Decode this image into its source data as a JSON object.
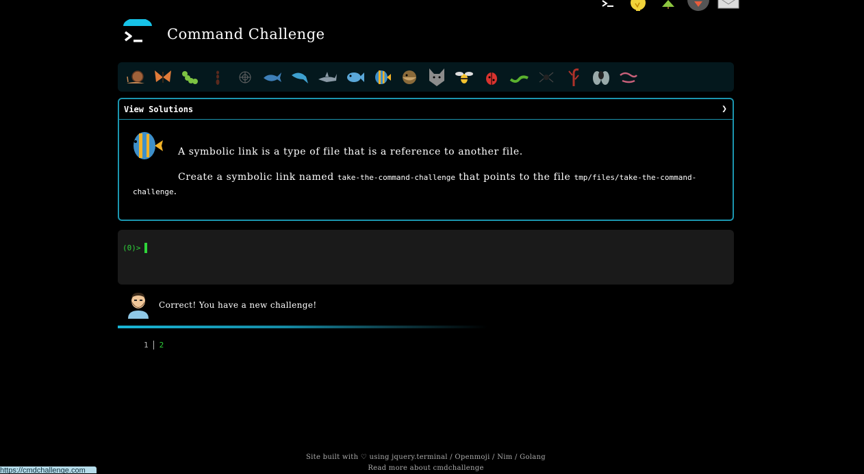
{
  "header": {
    "title": "Command Challenge"
  },
  "top_icons": [
    "terminal-icon",
    "bulb-icon",
    "tree-icon",
    "gem-icon",
    "mail-icon"
  ],
  "levels": [
    "snail",
    "butterfly",
    "caterpillar",
    "ant",
    "spider-web",
    "whale",
    "dolphin",
    "shark",
    "fish",
    "tropical-fish",
    "blowfish",
    "wolf",
    "bee",
    "ladybug",
    "worm",
    "spider",
    "scorpion",
    "fly",
    "earthworm"
  ],
  "panel": {
    "toggle_label": "View Solutions",
    "chevron": "❯",
    "desc_line1": "A symbolic link is a type of file that is a reference to another file.",
    "desc_line2_pre": "Create a symbolic link named ",
    "desc_code1": "take-the-command-challenge",
    "desc_line2_mid": " that points to the file ",
    "desc_code2": "tmp/files/take-the-command-challenge",
    "desc_line2_end": "."
  },
  "terminal": {
    "prompt": "(0)>"
  },
  "feedback": {
    "message": "Correct! You have a new challenge!"
  },
  "progress": {
    "fraction": 0.6
  },
  "steps": {
    "first": "1",
    "second": "2"
  },
  "footer": {
    "line1": "Site built with ♡ using jquery.terminal / Openmoji / Nim / Golang",
    "line2": "Read more about cmdchallenge"
  },
  "status_bar": {
    "url": "https://cmdchallenge.com"
  }
}
